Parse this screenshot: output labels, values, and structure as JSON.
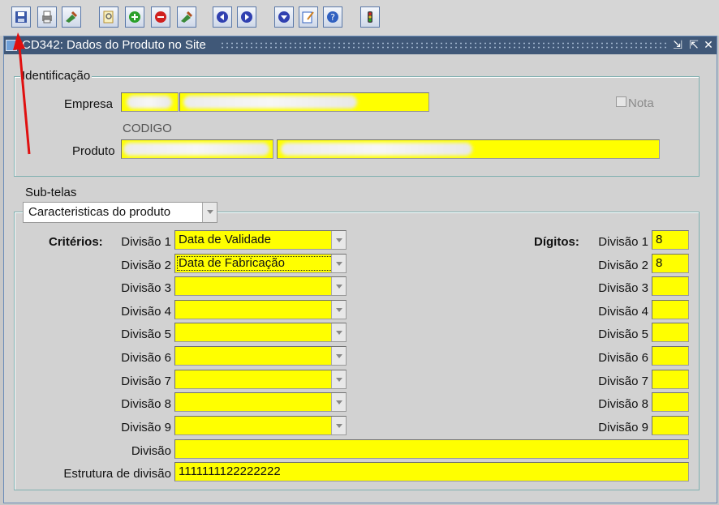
{
  "toolbar": {
    "buttons": [
      {
        "name": "save-icon",
        "color": "#3a58a8"
      },
      {
        "name": "print-icon",
        "color": "#777777"
      },
      {
        "name": "tools-icon",
        "color": "#3a8a3a"
      },
      {
        "name": "find-icon",
        "color": "#d8a020"
      },
      {
        "name": "insert-icon",
        "color": "#2aa02a"
      },
      {
        "name": "delete-icon",
        "color": "#d02020"
      },
      {
        "name": "clear-icon",
        "color": "#3a8a3a"
      },
      {
        "name": "previous-icon",
        "color": "#3040b0"
      },
      {
        "name": "next-icon",
        "color": "#3040b0"
      },
      {
        "name": "down-icon",
        "color": "#3040b0"
      },
      {
        "name": "edit-icon",
        "color": "#3060c0"
      },
      {
        "name": "help-icon",
        "color": "#3060c0"
      },
      {
        "name": "exit-icon",
        "color": "#c02020"
      }
    ]
  },
  "window": {
    "title": "CD342: Dados do Produto no Site",
    "minimize": "⇲",
    "maximize": "⇱",
    "close": "✕"
  },
  "identificacao": {
    "legend": "Identificação",
    "empresa_label": "Empresa",
    "codigo_label": "CODIGO",
    "produto_label": "Produto",
    "nota_label": "Nota"
  },
  "subtelas": {
    "label": "Sub-telas",
    "selected": "Caracteristicas do produto"
  },
  "criterios": {
    "label": "Critérios:",
    "digitos_label": "Dígitos:",
    "rows": [
      {
        "div_label": "Divisão 1",
        "value": "Data de Validade",
        "dig_label": "Divisão 1",
        "dig_value": "8"
      },
      {
        "div_label": "Divisão 2",
        "value": "Data de Fabricação",
        "dig_label": "Divisão 2",
        "dig_value": "8"
      },
      {
        "div_label": "Divisão 3",
        "value": "",
        "dig_label": "Divisão 3",
        "dig_value": ""
      },
      {
        "div_label": "Divisão 4",
        "value": "",
        "dig_label": "Divisão 4",
        "dig_value": ""
      },
      {
        "div_label": "Divisão 5",
        "value": "",
        "dig_label": "Divisão 5",
        "dig_value": ""
      },
      {
        "div_label": "Divisão 6",
        "value": "",
        "dig_label": "Divisão 6",
        "dig_value": ""
      },
      {
        "div_label": "Divisão 7",
        "value": "",
        "dig_label": "Divisão 7",
        "dig_value": ""
      },
      {
        "div_label": "Divisão 8",
        "value": "",
        "dig_label": "Divisão 8",
        "dig_value": ""
      },
      {
        "div_label": "Divisão 9",
        "value": "",
        "dig_label": "Divisão 9",
        "dig_value": ""
      }
    ],
    "divisao_label": "Divisão",
    "divisao_value": "",
    "estrutura_label": "Estrutura de divisão",
    "estrutura_value": "1111111122222222"
  },
  "colors": {
    "field_yellow": "#ffff00",
    "titlebar": "#405878",
    "annotation_arrow": "#e01010"
  }
}
